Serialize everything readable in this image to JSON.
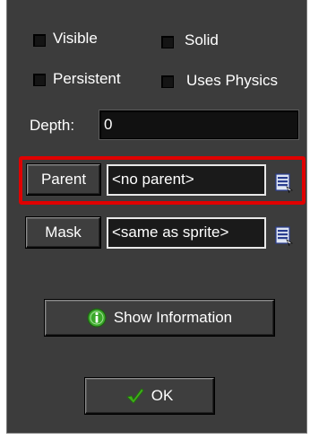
{
  "checkboxes": {
    "visible": "Visible",
    "solid": "Solid",
    "persistent": "Persistent",
    "uses_physics": "Uses Physics"
  },
  "depth": {
    "label": "Depth:",
    "value": "0"
  },
  "parent": {
    "button": "Parent",
    "value": "<no parent>"
  },
  "mask": {
    "button": "Mask",
    "value": "<same as sprite>"
  },
  "show_info": {
    "label": "Show Information"
  },
  "ok": {
    "label": "OK"
  },
  "colors": {
    "highlight": "#e00000",
    "ok_check": "#3fae1a",
    "info_icon": "#3aa82a"
  },
  "icons": [
    "info-icon",
    "checkmark-icon",
    "list-menu-icon"
  ]
}
